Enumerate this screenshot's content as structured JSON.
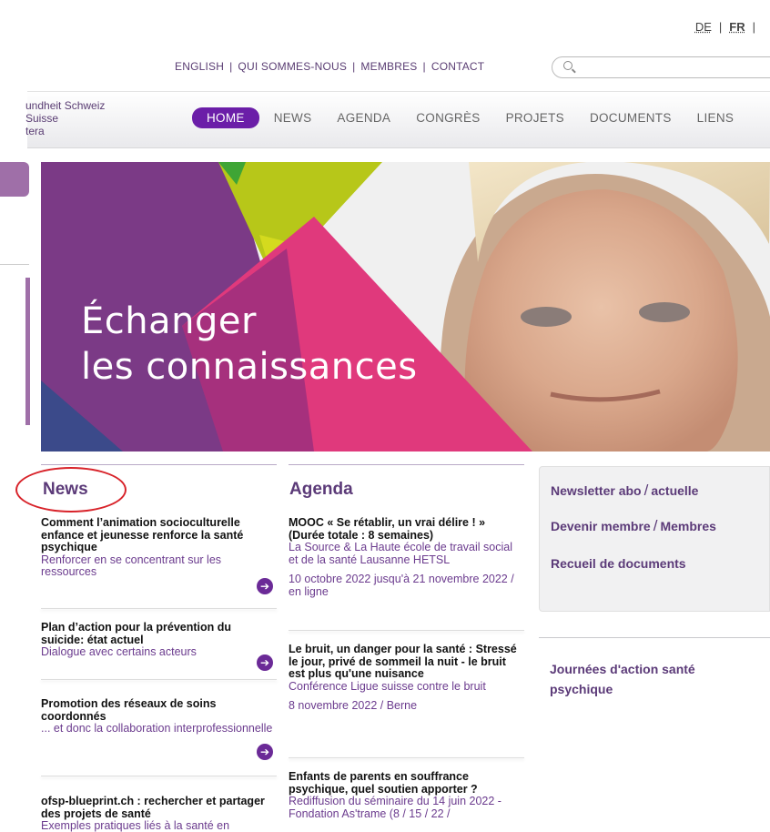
{
  "languages": [
    {
      "code": "DE",
      "active": false
    },
    {
      "code": "FR",
      "active": true
    }
  ],
  "top_links": [
    "ENGLISH",
    "QUI SOMMES-NOUS",
    "MEMBRES",
    "CONTACT"
  ],
  "search": {
    "placeholder": "",
    "value": ""
  },
  "logo": {
    "lines": [
      "undheit Schweiz",
      "Suisse",
      "tera"
    ]
  },
  "nav": [
    {
      "label": "HOME",
      "active": true
    },
    {
      "label": "NEWS",
      "active": false
    },
    {
      "label": "AGENDA",
      "active": false
    },
    {
      "label": "CONGRÈS",
      "active": false
    },
    {
      "label": "PROJETS",
      "active": false
    },
    {
      "label": "DOCUMENTS",
      "active": false
    },
    {
      "label": "LIENS",
      "active": false
    }
  ],
  "hero": {
    "line1": "Échanger",
    "line2": "les connaissances"
  },
  "news": {
    "title": "News",
    "items": [
      {
        "title": "Comment l’animation socioculturelle enfance et jeunesse renforce la santé psychique",
        "subtitle": "Renforcer en se concentrant sur les ressources"
      },
      {
        "title": "Plan d’action pour la prévention du suicide: état actuel",
        "subtitle": "Dialogue avec certains acteurs"
      },
      {
        "title": "Promotion des réseaux de soins coordonnés",
        "subtitle": "... et donc la collaboration interprofessionnelle"
      },
      {
        "title": "ofsp-blueprint.ch : rechercher et partager des projets de santé",
        "subtitle": "Exemples pratiques liés à la santé en"
      }
    ]
  },
  "agenda": {
    "title": "Agenda",
    "items": [
      {
        "title": "MOOC « Se rétablir, un vrai délire ! » (Durée totale : 8 semaines)",
        "subtitle": "La Source & La Haute école de travail social et de la santé Lausanne HETSL",
        "date": "10 octobre 2022 jusqu'à 21 novembre 2022 / en ligne"
      },
      {
        "title": "Le bruit, un danger pour la santé : Stressé le jour, privé de sommeil la nuit - le bruit est plus qu'une nuisance",
        "subtitle": "Conférence Ligue suisse contre le bruit",
        "date": "8 novembre 2022 / Berne"
      },
      {
        "title": "Enfants de parents en souffrance psychique, quel soutien apporter ?",
        "subtitle": "Rediffusion du séminaire du 14 juin 2022 - Fondation As'trame (8 / 15 / 22 /",
        "date": ""
      }
    ]
  },
  "sidebar": {
    "newsletter": {
      "a": "Newsletter abo",
      "b": "actuelle"
    },
    "membre": {
      "a": "Devenir membre",
      "b": "Membres"
    },
    "recueil": "Recueil de documents",
    "journees": "Journées d'action santé psychique"
  },
  "colors": {
    "accent": "#6b1ea8",
    "title": "#5b3a78",
    "link": "#6b3b8e",
    "annotation": "#d8232a"
  }
}
